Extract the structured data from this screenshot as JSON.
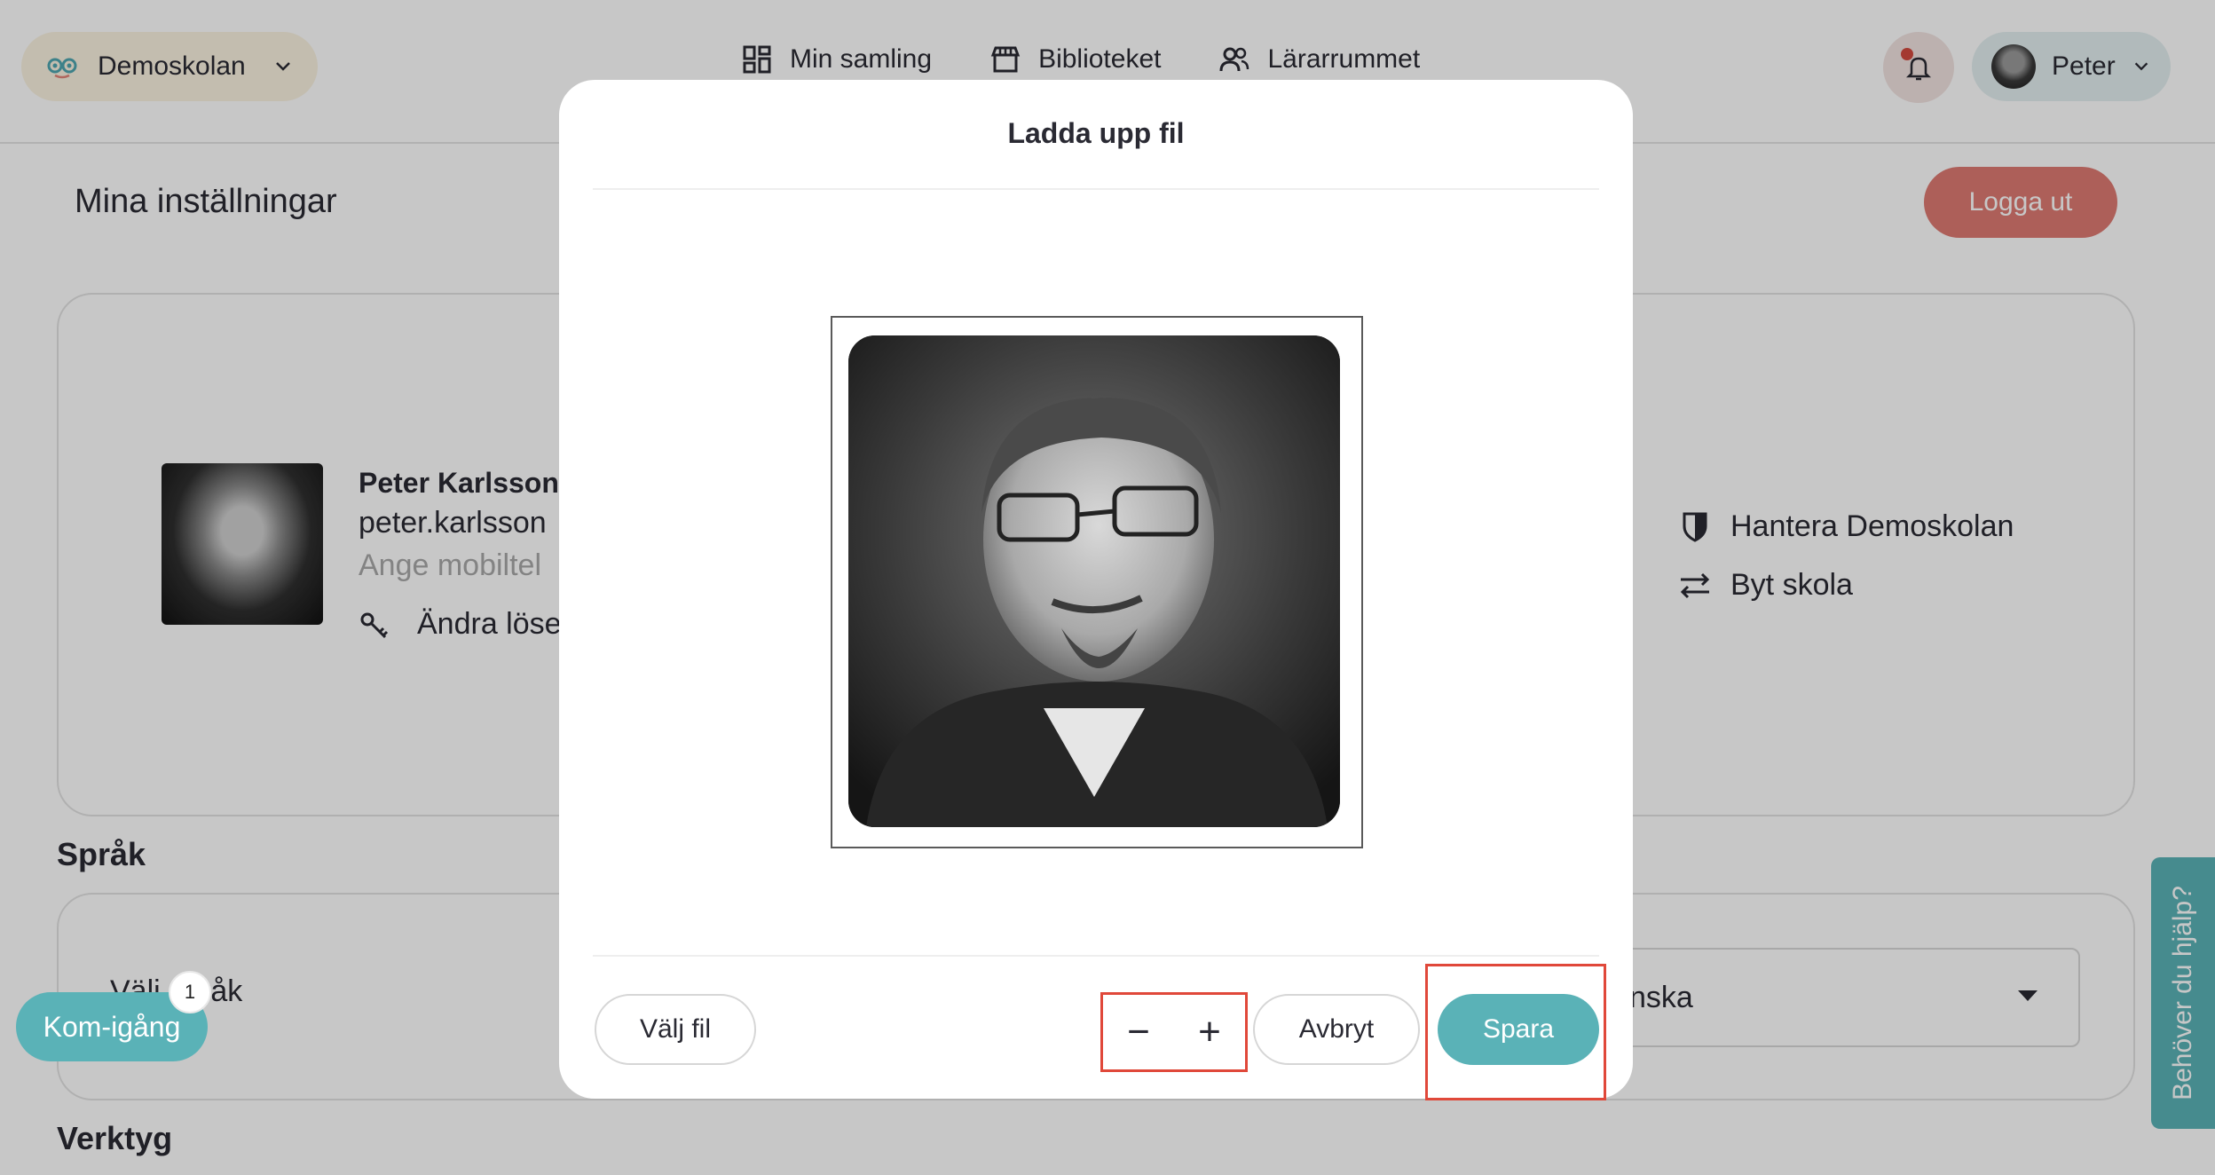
{
  "header": {
    "school_name": "Demoskolan",
    "nav": [
      {
        "label": "Min samling",
        "icon": "grid-icon"
      },
      {
        "label": "Biblioteket",
        "icon": "store-icon"
      },
      {
        "label": "Lärarrummet",
        "icon": "people-icon"
      }
    ],
    "user_name": "Peter"
  },
  "settings": {
    "title": "Mina inställningar",
    "logout_label": "Logga ut",
    "profile": {
      "name": "Peter Karlsson",
      "email": "peter.karlsson",
      "phone_placeholder": "Ange mobiltel",
      "change_password": "Ändra löse"
    },
    "side_links": {
      "manage_school": "Hantera Demoskolan",
      "switch_school": "Byt skola"
    },
    "language_section": "Språk",
    "language_label": "Välj språk",
    "language_value": "nska",
    "tools_section": "Verktyg"
  },
  "onboarding": {
    "label": "Kom-igång",
    "badge": "1"
  },
  "help_tab": "Behöver du hjälp?",
  "modal": {
    "title": "Ladda upp fil",
    "choose_file": "Välj fil",
    "zoom_out": "−",
    "zoom_in": "+",
    "cancel": "Avbryt",
    "save": "Spara"
  },
  "colors": {
    "accent": "#5ab2b7",
    "logout": "#de7a72",
    "highlight": "#e0483a"
  }
}
